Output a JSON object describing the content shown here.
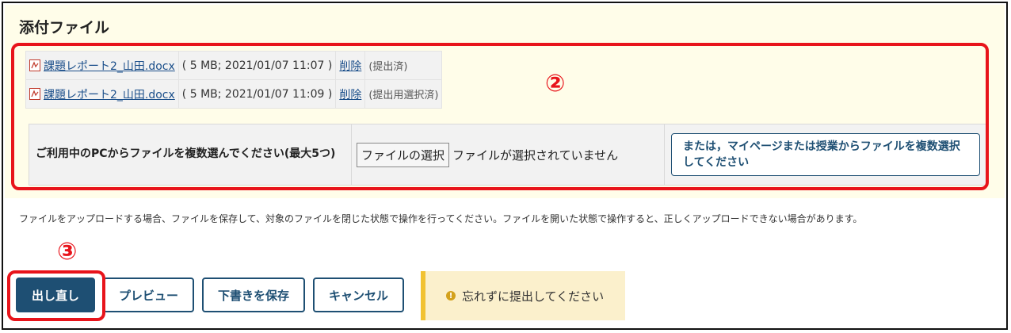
{
  "section": {
    "title": "添付ファイル"
  },
  "files": [
    {
      "name": "課題レポート2_山田.docx",
      "meta": "( 5 MB; 2021/01/07 11:07 )",
      "delete": "削除",
      "status": "(提出済)"
    },
    {
      "name": "課題レポート2_山田.docx",
      "meta": "( 5 MB; 2021/01/07 11:09 )",
      "delete": "削除",
      "status": "(提出用選択済)"
    }
  ],
  "upload": {
    "label": "ご利用中のPCからファイルを複数選んでください(最大5つ)",
    "choose_button": "ファイルの選択",
    "no_file": "ファイルが選択されていません",
    "alt_button": "または，マイページまたは授業からファイルを複数選択してください"
  },
  "notice": "ファイルをアップロードする場合、ファイルを保存して、対象のファイルを閉じた状態で操作を行ってください。ファイルを開いた状態で操作すると、正しくアップロードできない場合があります。",
  "buttons": {
    "resubmit": "出し直し",
    "preview": "プレビュー",
    "save_draft": "下書きを保存",
    "cancel": "キャンセル"
  },
  "alert": {
    "text": "忘れずに提出してください"
  },
  "markers": {
    "files_area": "②",
    "resubmit": "③"
  },
  "colors": {
    "accent": "#1e4f73",
    "highlight": "#e8141b",
    "section_bg": "#fffde9",
    "alert_bg": "#fbf0cc"
  }
}
